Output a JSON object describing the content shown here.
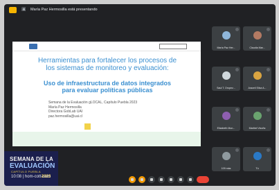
{
  "topbar": {
    "presenting_text": "María Paz Hermosilla está presentando"
  },
  "slide": {
    "title_line1": "Herramientas para fortalecer los procesos de",
    "title_line2": "los sistemas de monitoreo y evaluación:",
    "subtitle_line1": "Uso de infraestructura de datos integrados",
    "subtitle_line2": "para evaluar políticas públicas",
    "details": [
      "Semana de la Evaluación gLOCAL, Capítulo Puebla 2023",
      "María Paz Hermosilla",
      "Directora GobLab UAI",
      "paz.hermosilla@uai.cl"
    ]
  },
  "self_view": {
    "line1": "SEMANA DE LA",
    "line2": "EVALUACIÓN",
    "line3": "CAPÍTULO PUEBLA",
    "year": "2023"
  },
  "meeting_info": {
    "time_code": "10:08 | hom-cott-uom"
  },
  "participants": [
    {
      "name": "María Paz Her...",
      "avatar_color": "#8fb6d9"
    },
    {
      "name": "Claudia Mar...",
      "avatar_color": "#b37a63"
    },
    {
      "name": "Saul T. Oropez...",
      "avatar_color": "#cfd8dc"
    },
    {
      "name": "Araceli Silva A...",
      "avatar_color": "#d9a441"
    },
    {
      "name": "Elizabeth Mun...",
      "avatar_color": "#8e5fb0"
    },
    {
      "name": "Maribel Vicuña",
      "avatar_color": "#6aa36f"
    },
    {
      "name": "109 más",
      "avatar_color": "#8f9a9f"
    },
    {
      "name": "Tú",
      "avatar_color": "#2a79c6"
    }
  ]
}
